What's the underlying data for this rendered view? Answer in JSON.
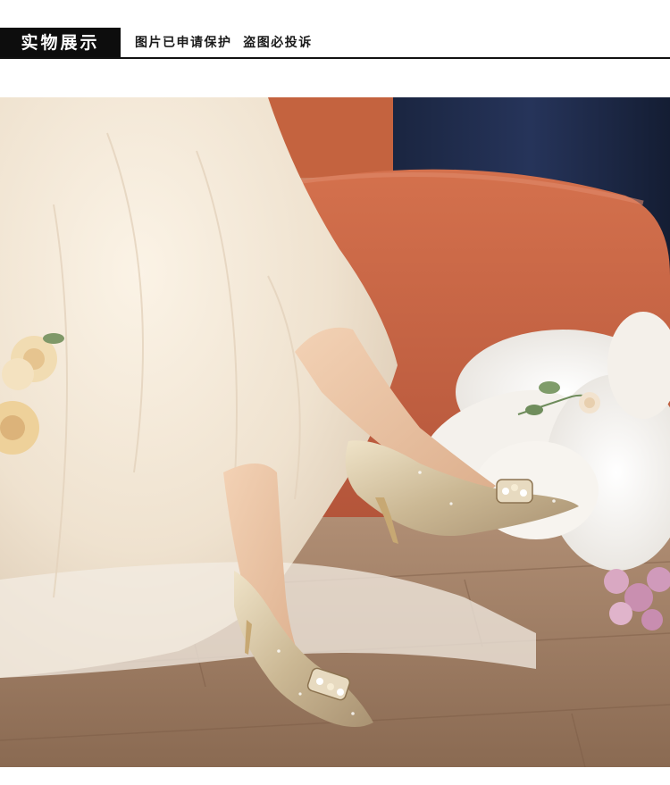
{
  "header": {
    "tag_label": "实物展示",
    "note": "图片已申请保护  盗图必投诉"
  },
  "photo": {
    "subject": "bridal-high-heel-pumps"
  }
}
